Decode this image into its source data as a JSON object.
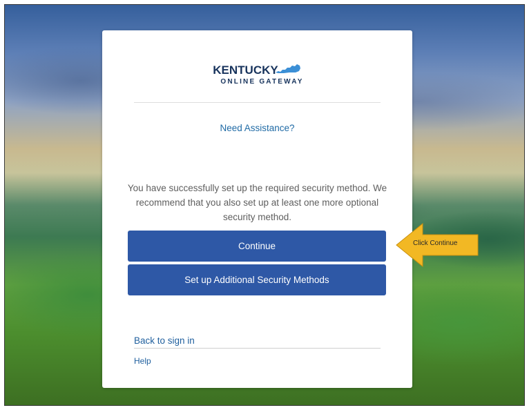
{
  "logo": {
    "title": "KENTUCKY",
    "subtitle": "ONLINE GATEWAY",
    "icon": "kentucky-state-icon"
  },
  "assistance_link": "Need Assistance?",
  "message": "You have successfully set up the required security method. We recommend that you also set up at least one more optional security method.",
  "buttons": {
    "continue": "Continue",
    "additional": "Set up Additional Security Methods"
  },
  "footer": {
    "back_link": "Back to sign in",
    "help_link": "Help"
  },
  "callout": {
    "text": "Click Continue",
    "color": "#f2b824"
  },
  "colors": {
    "primary_button": "#2e58a6",
    "link": "#1f6aa5",
    "brand_navy": "#17335c",
    "brand_blue": "#3b8fd6"
  }
}
